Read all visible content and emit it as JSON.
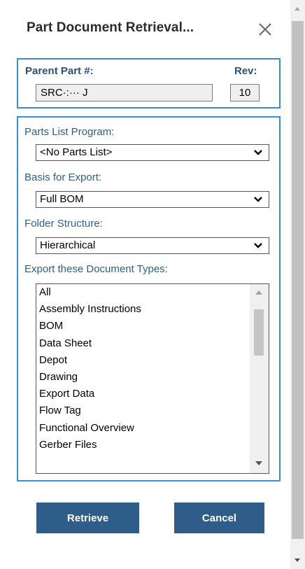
{
  "dialog": {
    "title": "Part Document Retrieval...",
    "close_icon": "close-icon"
  },
  "part": {
    "parent_label": "Parent Part #:",
    "parent_value": "SRC·:··· J",
    "rev_label": "Rev:",
    "rev_value": "10"
  },
  "options": {
    "parts_list_label": "Parts List Program:",
    "parts_list_value": "<No Parts List>",
    "basis_label": "Basis for Export:",
    "basis_value": "Full BOM",
    "folder_label": "Folder Structure:",
    "folder_value": "Hierarchical",
    "doc_types_label": "Export these Document Types:",
    "doc_types": [
      "All",
      "Assembly Instructions",
      "BOM",
      "Data Sheet",
      "Depot",
      "Drawing",
      "Export Data",
      "Flow Tag",
      "Functional Overview",
      "Gerber Files"
    ]
  },
  "actions": {
    "retrieve_label": "Retrieve",
    "cancel_label": "Cancel"
  },
  "colors": {
    "accent_border": "#3b8ecf",
    "button_bg": "#2e5d8a",
    "label_text": "#2d5f8f"
  }
}
